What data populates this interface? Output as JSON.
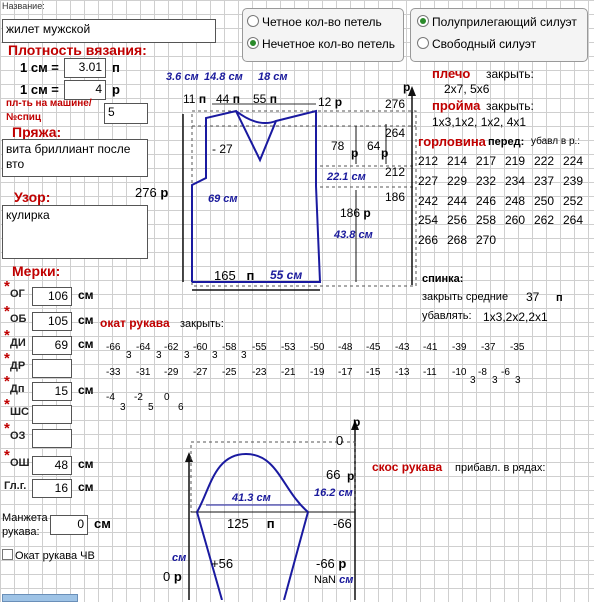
{
  "title_label": "Название:",
  "title_value": "жилет мужской",
  "radio_loops": [
    {
      "label": "Четное кол-во петель",
      "selected": false
    },
    {
      "label": "Нечетное кол-во петель",
      "selected": true
    }
  ],
  "radio_fit": [
    {
      "label": "Полуприлегающий силуэт",
      "selected": true
    },
    {
      "label": "Свободный силуэт",
      "selected": false
    }
  ],
  "density": {
    "heading": "Плотность вязания:",
    "row1_label": "1 см =",
    "row1_value": "3.01",
    "row1_unit": "п",
    "row2_label": "1 см =",
    "row2_value": "4",
    "row2_unit": "р",
    "machine_label": "пл-ть на машине/",
    "needle_label": "№спиц",
    "needle_value": "5"
  },
  "yarn": {
    "heading": "Пряжа:",
    "value": "вита бриллиант после вто"
  },
  "pattern": {
    "heading": "Узор:",
    "value": "кулирка"
  },
  "measures": {
    "heading": "Мерки:",
    "unit": "см",
    "items": [
      {
        "label": "ОГ",
        "value": "106"
      },
      {
        "label": "ОБ",
        "value": "105"
      },
      {
        "label": "ДИ",
        "value": "69"
      },
      {
        "label": "ДР",
        "value": ""
      },
      {
        "label": "Дп",
        "value": "15"
      },
      {
        "label": "ШС",
        "value": ""
      },
      {
        "label": "ОЗ",
        "value": ""
      },
      {
        "label": "ОШ",
        "value": "48"
      },
      {
        "label": "Гл.г.",
        "value": "16"
      }
    ]
  },
  "cuff": {
    "label1": "Манжета",
    "label2": "рукава:",
    "value": "0",
    "unit": "см"
  },
  "checkbox": {
    "label": "Окат рукава ЧВ"
  },
  "body_diagram": {
    "top_cm": [
      "3.6 см",
      "14.8 см",
      "18 см"
    ],
    "top_st": [
      "11",
      "п",
      "44",
      "п",
      "55",
      "п",
      "12",
      "р"
    ],
    "r276_top": "276",
    "p_arrow": "р",
    "r264": "264",
    "r212": "212",
    "r186": "186",
    "r78": "78",
    "p_78": "р",
    "r64": "64",
    "p_64": "р",
    "minus27": "- 27",
    "cm221": "22.1 см",
    "cm69": "69 см",
    "r186b": "186",
    "p_186": "р",
    "cm438": "43.8 см",
    "left276": "276",
    "left_p": "р",
    "bottom_165": "165",
    "bottom_p": "п",
    "bottom_cm": "55 см"
  },
  "shoulder": {
    "heading": "плечо",
    "action": "закрыть:",
    "values": "2x7,  5x6"
  },
  "armhole": {
    "heading": "пройма",
    "action": "закрыть:",
    "values": "1x3,1x2,  1x2,  4x1"
  },
  "neck": {
    "heading": "горловина",
    "front": "перед:",
    "dec": "убавл в р.:",
    "rows": [
      [
        "212",
        "214",
        "217",
        "219",
        "222",
        "224"
      ],
      [
        "227",
        "229",
        "232",
        "234",
        "237",
        "239"
      ],
      [
        "242",
        "244",
        "246",
        "248",
        "250",
        "252"
      ],
      [
        "254",
        "256",
        "258",
        "260",
        "262",
        "264"
      ],
      [
        "266",
        "268",
        "270"
      ]
    ]
  },
  "back": {
    "heading": "спинка:",
    "close_label": "закрыть средние",
    "close_value": "37",
    "close_unit": "п",
    "dec_label": "убавлять:",
    "dec_values": "1x3,2x2,2x1"
  },
  "sleeve_cap": {
    "heading": "окат рукава",
    "action": "закрыть:",
    "row1": [
      "-66",
      "-64",
      "-62",
      "-60",
      "-58",
      "-55",
      "-53",
      "-50",
      "-48",
      "-45",
      "-43",
      "-41",
      "-39",
      "-37",
      "-35"
    ],
    "row1_subs": [
      "3",
      "3",
      "3",
      "3",
      "3"
    ],
    "row2": [
      "-33",
      "-31",
      "-29",
      "-27",
      "-25",
      "-23",
      "-21",
      "-19",
      "-17",
      "-15",
      "-13",
      "-11",
      "-10",
      "-8",
      "-6"
    ],
    "row2_subs": [
      "3",
      "3",
      "3"
    ],
    "row3": [
      "-4",
      "-2",
      "0"
    ],
    "row3_subs": [
      "3",
      "5",
      "6"
    ]
  },
  "sleeve_diagram": {
    "zero_top": "0",
    "p_top": "р",
    "r66": "66",
    "p_66": "р",
    "cm162": "16.2 см",
    "cm413": "41.3 см",
    "st125": "125",
    "st_p": "п",
    "minus66a": "-66",
    "cm_left": "см",
    "zero_left": "0",
    "p_left": "р",
    "plus56": "+56",
    "minus66b": "-66",
    "p_66b": "р",
    "nan": "NaN",
    "nan_cm": "см"
  },
  "sleeve_bevel": {
    "heading": "скос рукава",
    "action": "прибавл. в рядах:"
  }
}
